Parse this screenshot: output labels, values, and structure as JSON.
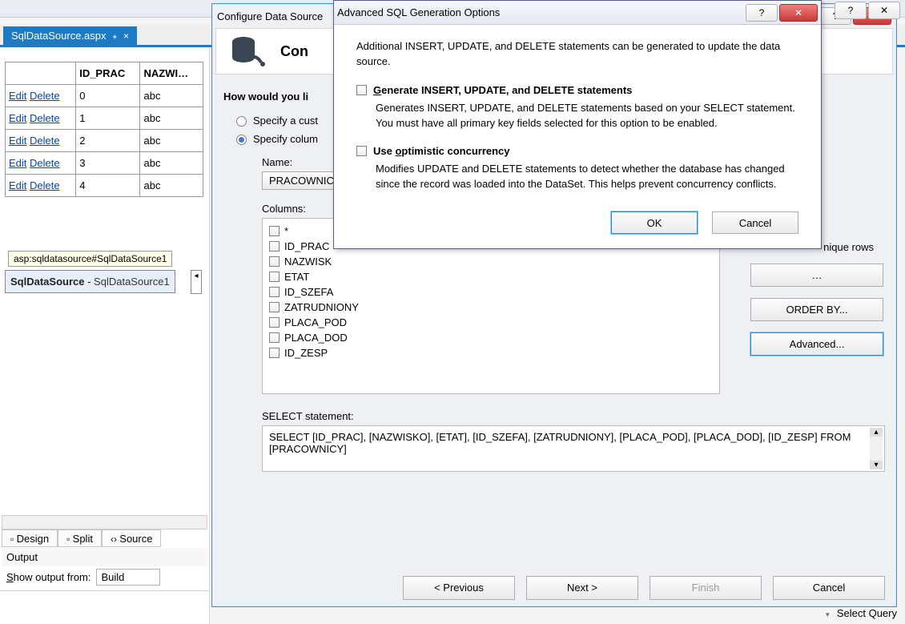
{
  "top_tab": {
    "filename": "SqlDataSource.aspx",
    "pin": "⁎",
    "close": "×"
  },
  "table": {
    "headers": [
      "",
      "ID_PRAC",
      "NAZWI…"
    ],
    "rows": [
      {
        "edit": "Edit",
        "del": "Delete",
        "id": "0",
        "n": "abc"
      },
      {
        "edit": "Edit",
        "del": "Delete",
        "id": "1",
        "n": "abc"
      },
      {
        "edit": "Edit",
        "del": "Delete",
        "id": "2",
        "n": "abc"
      },
      {
        "edit": "Edit",
        "del": "Delete",
        "id": "3",
        "n": "abc"
      },
      {
        "edit": "Edit",
        "del": "Delete",
        "id": "4",
        "n": "abc"
      }
    ]
  },
  "asp_tooltip": "asp:sqldatasource#SqlDataSource1",
  "ds_pill": {
    "name": "SqlDataSource",
    "sep": " - ",
    "suf": "SqlDataSource1"
  },
  "views": {
    "design": "Design",
    "split": "Split",
    "source": "Source"
  },
  "output": {
    "header": "Output",
    "label": "how output from:",
    "s": "S",
    "selected": "Build"
  },
  "wizard1": {
    "title": "Configure Data Source",
    "header": "Con",
    "how": "How would you li",
    "radio1": "Specify a cust",
    "radio2": "Specify colum",
    "name_lbl": "Name:",
    "name_val": "PRACOWNIC",
    "cols_lbl": "Columns:",
    "cols": [
      "*",
      "ID_PRAC",
      "NAZWISK",
      "ETAT",
      "ID_SZEFA",
      "ZATRUDNIONY",
      "PLACA_POD",
      "PLACA_DOD",
      "ID_ZESP"
    ],
    "only_unique": "nique rows",
    "btn_where": "…",
    "btn_order": "ORDER BY...",
    "btn_adv": "Advanced...",
    "sel_lbl": "SELECT statement:",
    "sel_text": "SELECT [ID_PRAC], [NAZWISKO], [ETAT], [ID_SZEFA], [ZATRUDNIONY], [PLACA_POD], [PLACA_DOD], [ID_ZESP] FROM [PRACOWNICY]",
    "prev": "< Previous",
    "next": "Next >",
    "finish": "Finish",
    "cancel": "Cancel"
  },
  "dialog2": {
    "title": "Advanced SQL Generation Options",
    "intro": "Additional INSERT, UPDATE, and DELETE statements can be generated to update the data source.",
    "opt1_label_pre": "",
    "opt1_G": "G",
    "opt1_label_post": "enerate INSERT, UPDATE, and DELETE statements",
    "opt1_desc": "Generates INSERT, UPDATE, and DELETE statements based on your SELECT statement. You must have all primary key fields selected for this option to be enabled.",
    "opt2_label_pre": "Use ",
    "opt2_o": "o",
    "opt2_label_post": "ptimistic concurrency",
    "opt2_desc": "Modifies UPDATE and DELETE statements to detect whether the database has changed since the record was loaded into the DataSet. This helps prevent concurrency conflicts.",
    "ok": "OK",
    "cancel": "Cancel"
  },
  "status_right": {
    "arrow": "▾",
    "text": "Select Query"
  }
}
